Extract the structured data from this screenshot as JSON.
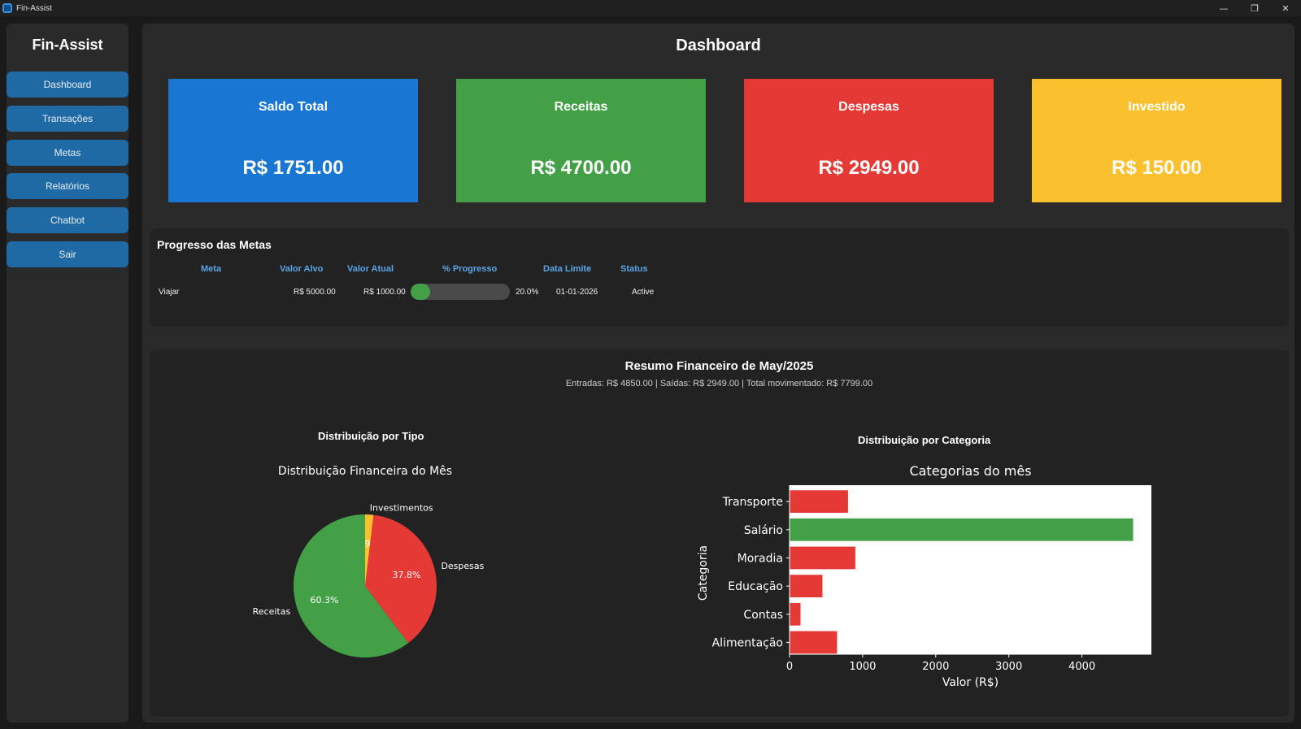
{
  "window": {
    "title": "Fin-Assist",
    "minimize": "—",
    "restore": "❐",
    "close": "✕"
  },
  "sidebar": {
    "brand": "Fin-Assist",
    "items": [
      {
        "label": "Dashboard"
      },
      {
        "label": "Transações"
      },
      {
        "label": "Metas"
      },
      {
        "label": "Relatórios"
      },
      {
        "label": "Chatbot"
      },
      {
        "label": "Sair"
      }
    ]
  },
  "dashboard": {
    "title": "Dashboard",
    "cards": [
      {
        "title": "Saldo Total",
        "value": "R$ 1751.00",
        "color": "#1976d2"
      },
      {
        "title": "Receitas",
        "value": "R$ 4700.00",
        "color": "#43a047"
      },
      {
        "title": "Despesas",
        "value": "R$ 2949.00",
        "color": "#e53935"
      },
      {
        "title": "Investido",
        "value": "R$ 150.00",
        "color": "#fbc02d"
      }
    ]
  },
  "goals": {
    "title": "Progresso das Metas",
    "headers": [
      "Meta",
      "Valor Alvo",
      "Valor Atual",
      "% Progresso",
      "Data Limite",
      "Status"
    ],
    "rows": [
      {
        "meta": "Viajar",
        "alvo": "R$ 5000.00",
        "atual": "R$ 1000.00",
        "progress": 0.2,
        "pct": "20.0%",
        "data": "01-01-2026",
        "status": "Active"
      }
    ]
  },
  "summary": {
    "title": "Resumo Financeiro de May/2025",
    "subtitle": "Entradas: R$ 4850.00  |  Saídas: R$ 2949.00  |  Total movimentado: R$ 7799.00",
    "tipo_title": "Distribuição por Tipo",
    "categoria_title": "Distribuição por Categoria"
  },
  "chart_data": [
    {
      "type": "pie",
      "title": "Distribuição Financeira do Mês",
      "labels": [
        "Investimentos",
        "Despesas",
        "Receitas"
      ],
      "values": [
        1.9,
        37.8,
        60.3
      ],
      "value_labels": [
        "1.9%",
        "37.8%",
        "60.3%"
      ],
      "colors": [
        "#fbc02d",
        "#e53935",
        "#43a047"
      ]
    },
    {
      "type": "bar",
      "orientation": "horizontal",
      "title": "Categorias do mês",
      "categories": [
        "Transporte",
        "Salário",
        "Moradia",
        "Educação",
        "Contas",
        "Alimentação"
      ],
      "values": [
        800,
        4700,
        900,
        450,
        150,
        650
      ],
      "colors": [
        "#e53935",
        "#43a047",
        "#e53935",
        "#e53935",
        "#e53935",
        "#e53935"
      ],
      "xlabel": "Valor (R$)",
      "ylabel": "Categoria",
      "xticks": [
        0,
        1000,
        2000,
        3000,
        4000
      ],
      "xlim": [
        0,
        4950
      ]
    }
  ]
}
